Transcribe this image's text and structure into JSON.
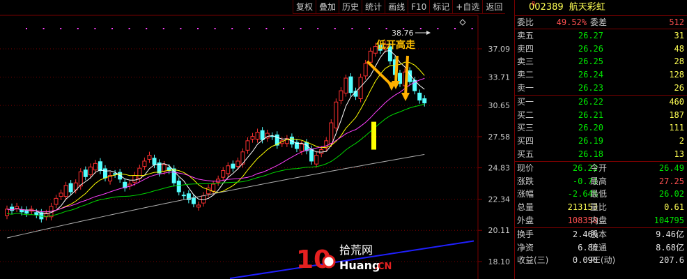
{
  "toolbar": [
    "复权",
    "叠加",
    "历史",
    "统计",
    "画线",
    "F10",
    "标记",
    "+自选",
    "返回"
  ],
  "stock": {
    "code": "002389",
    "name": "航天彩虹",
    "market_mark": "R"
  },
  "quote": {
    "weibi": {
      "label": "委比",
      "value": "49.52%",
      "label2": "委差",
      "value2": "512"
    },
    "sell": [
      {
        "label": "卖五",
        "price": "26.27",
        "vol": "31"
      },
      {
        "label": "卖四",
        "price": "26.26",
        "vol": "48"
      },
      {
        "label": "卖三",
        "price": "26.25",
        "vol": "28"
      },
      {
        "label": "卖二",
        "price": "26.24",
        "vol": "128"
      },
      {
        "label": "卖一",
        "price": "26.23",
        "vol": "26"
      }
    ],
    "buy": [
      {
        "label": "买一",
        "price": "26.22",
        "vol": "460"
      },
      {
        "label": "买二",
        "price": "26.21",
        "vol": "187"
      },
      {
        "label": "买三",
        "price": "26.20",
        "vol": "111"
      },
      {
        "label": "买四",
        "price": "26.19",
        "vol": "2"
      },
      {
        "label": "买五",
        "price": "26.18",
        "vol": "13"
      }
    ],
    "stats": [
      {
        "l1": "现价",
        "v1": "26.22",
        "c1": "green",
        "l2": "今开",
        "v2": "26.49",
        "c2": "green"
      },
      {
        "l1": "涨跌",
        "v1": "-0.71",
        "c1": "green",
        "l2": "最高",
        "v2": "27.25",
        "c2": "red"
      },
      {
        "l1": "涨幅",
        "v1": "-2.64%",
        "c1": "green",
        "l2": "最低",
        "v2": "26.02",
        "c2": "green"
      },
      {
        "l1": "总量",
        "v1": "213153",
        "c1": "yellow",
        "l2": "量比",
        "v2": "0.61",
        "c2": "yellow"
      },
      {
        "l1": "外盘",
        "v1": "108358",
        "c1": "red",
        "l2": "内盘",
        "v2": "104795",
        "c2": "green"
      }
    ],
    "fund": [
      {
        "l1": "换手",
        "v1": "2.46%",
        "l2": "股本",
        "v2": "9.46亿"
      },
      {
        "l1": "净资",
        "v1": "6.86",
        "l2": "流通",
        "v2": "8.68亿"
      },
      {
        "l1": "收益(三)",
        "v1": "0.090",
        "l2": "PE(动)",
        "v2": "207.6"
      }
    ]
  },
  "chart": {
    "price_labels": [
      "37.09",
      "33.71",
      "30.65",
      "27.58",
      "24.83",
      "22.34",
      "20.11",
      "18.10"
    ],
    "high_marker": "38.76",
    "annotation": "低开高走",
    "colors": {
      "up": "#ff3030",
      "down": "#54ffff",
      "ma5": "#ffffff",
      "ma10": "#ffff00",
      "ma20": "#ff40ff",
      "ma30": "#00d800",
      "ma60": "#b0b0b0",
      "ma120": "#2020ff"
    }
  },
  "watermark": {
    "num": "10",
    "cn": "拾荒网",
    "en": "Huang",
    "tld": ".CN"
  }
}
